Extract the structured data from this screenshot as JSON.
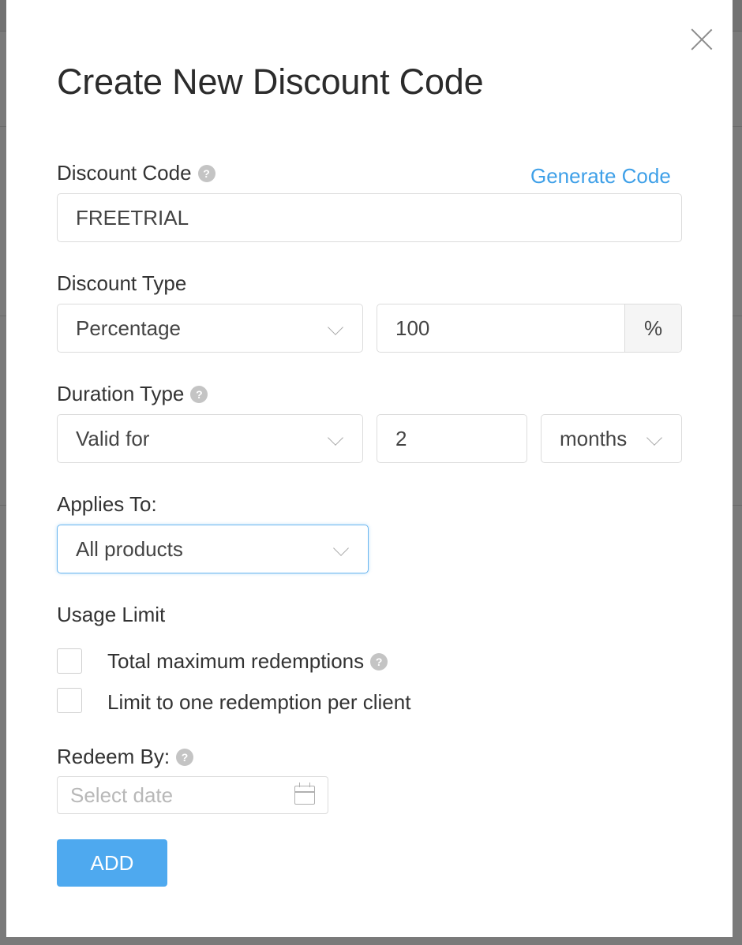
{
  "modal": {
    "title": "Create New Discount Code",
    "close_icon": "close-icon"
  },
  "discount_code": {
    "label": "Discount Code",
    "generate_link": "Generate Code",
    "value": "FREETRIAL"
  },
  "discount_type": {
    "label": "Discount Type",
    "type_value": "Percentage",
    "amount_value": "100",
    "unit": "%"
  },
  "duration_type": {
    "label": "Duration Type",
    "type_value": "Valid for",
    "count_value": "2",
    "period_value": "months"
  },
  "applies_to": {
    "label": "Applies To:",
    "value": "All products"
  },
  "usage_limit": {
    "label": "Usage Limit",
    "options": [
      {
        "label": "Total maximum redemptions",
        "checked": false
      },
      {
        "label": "Limit to one redemption per client",
        "checked": false
      }
    ]
  },
  "redeem_by": {
    "label": "Redeem By:",
    "placeholder": "Select date"
  },
  "help_glyph": "?",
  "submit_label": "ADD",
  "colors": {
    "accent": "#4ea9ef",
    "link": "#3fa0e8",
    "focus_border": "#6ab6f0"
  }
}
